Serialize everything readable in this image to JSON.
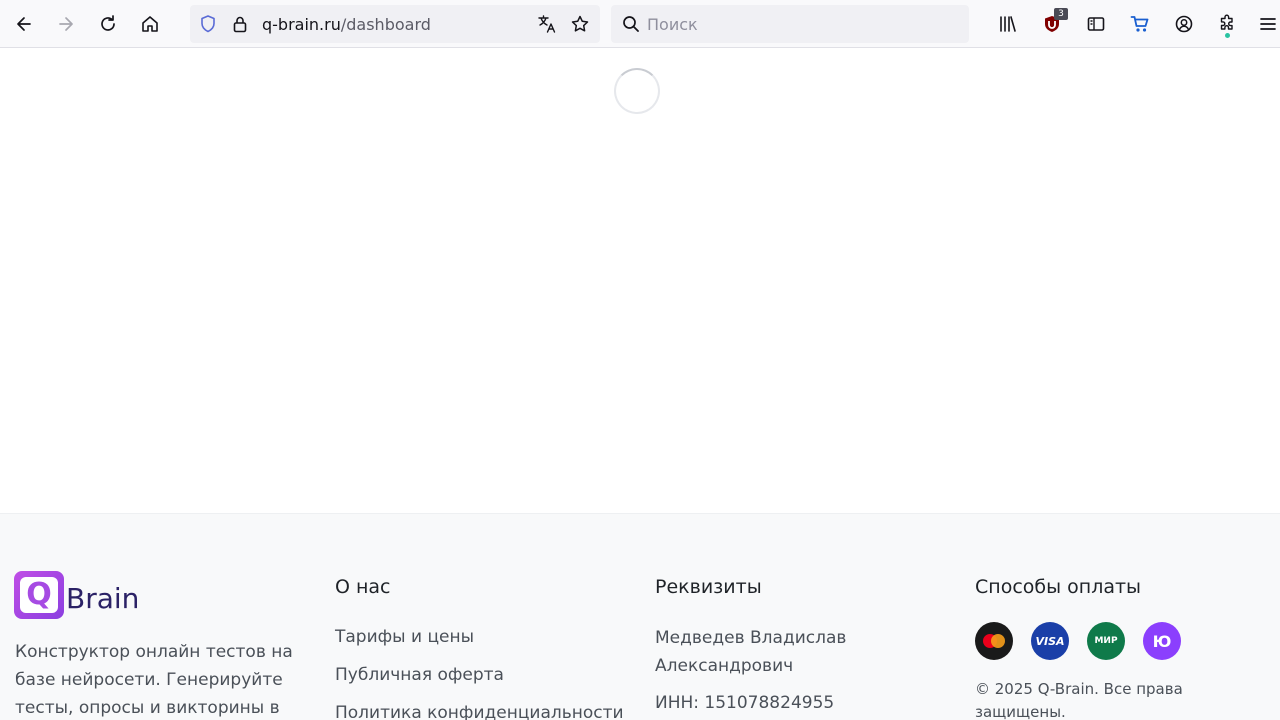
{
  "browser": {
    "url_domain": "q-brain.ru",
    "url_path": "/dashboard",
    "search_placeholder": "Поиск",
    "extension_badge": "3",
    "icons": [
      "back-icon",
      "forward-icon",
      "reload-icon",
      "home-icon",
      "shield-icon",
      "lock-icon",
      "translate-icon",
      "star-icon",
      "search-icon",
      "library-icon",
      "ublock-icon",
      "sidebar-icon",
      "cart-icon",
      "account-icon",
      "extensions-icon",
      "menu-icon"
    ]
  },
  "footer": {
    "logo_letter": "Q",
    "logo_text": "Brain",
    "description": "Конструктор онлайн тестов на базе нейросети. Генерируйте тесты, опросы и викторины в",
    "about": {
      "heading": "О нас",
      "links": [
        "Тарифы и цены",
        "Публичная оферта",
        "Политика конфиденциальности"
      ]
    },
    "requisites": {
      "heading": "Реквизиты",
      "name": "Медведев Владислав Александрович",
      "inn": "ИНН: 151078824955"
    },
    "payment": {
      "heading": "Способы оплаты",
      "methods": [
        {
          "name": "mastercard",
          "label": "",
          "color": "#1a1a1a"
        },
        {
          "name": "visa",
          "label": "VISA",
          "color": "#1a3fa8"
        },
        {
          "name": "mir",
          "label": "МИР",
          "color": "#0f7a4a"
        },
        {
          "name": "yoomoney",
          "label": "Ю",
          "color": "#8b3ffd"
        }
      ],
      "copyright": "© 2025 Q-Brain. Все права защищены."
    }
  }
}
